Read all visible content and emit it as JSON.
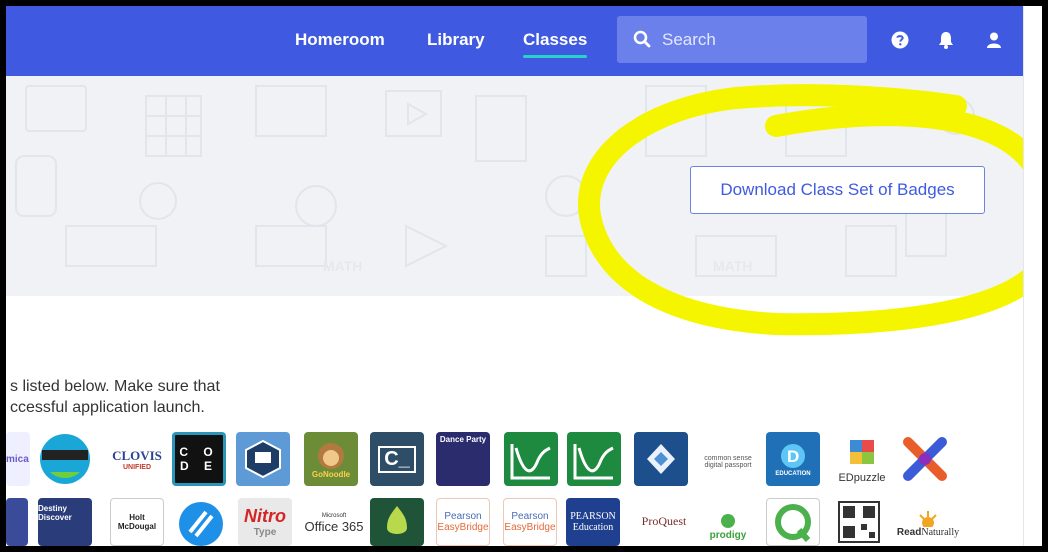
{
  "nav": {
    "links": [
      "Homeroom",
      "Library",
      "Classes"
    ],
    "search_placeholder": "Search",
    "icons": [
      "help-icon",
      "bell-icon",
      "user-icon"
    ]
  },
  "hero": {
    "download_button": "Download Class Set of Badges"
  },
  "content": {
    "line1": "s listed below. Make sure that",
    "line2": "ccessful application launch."
  },
  "apps_row1": {
    "a0": "mica",
    "a2_1": "CLOVIS",
    "a2_2": "UNIFIED",
    "a3_1": "C O",
    "a3_2": "D E",
    "a5": "GoNoodle",
    "a6": "C_",
    "a7": "Dance Party",
    "a11": "common sense digital passport",
    "a12": "EDUCATION",
    "a13": "EDpuzzle"
  },
  "apps_row2": {
    "b1": "Destiny Discover",
    "b2_1": "Holt",
    "b2_2": "McDougal",
    "b4_1": "Nitro",
    "b4_2": "Type",
    "b5_1": "Microsoft",
    "b5_2": "Office 365",
    "b7_1": "Pearson",
    "b7_2": "EasyBridge",
    "b8_1": "Pearson",
    "b8_2": "EasyBridge",
    "b9_1": "PEARSON",
    "b9_2": "Education",
    "b10": "ProQuest",
    "b11": "prodigy",
    "b14_1": "Read",
    "b14_2": "Naturally"
  },
  "colors": {
    "nav": "#3f5ae0",
    "accent_underline": "#27d3c9",
    "highlight": "#f5f500",
    "button_text": "#3f5ae0"
  }
}
